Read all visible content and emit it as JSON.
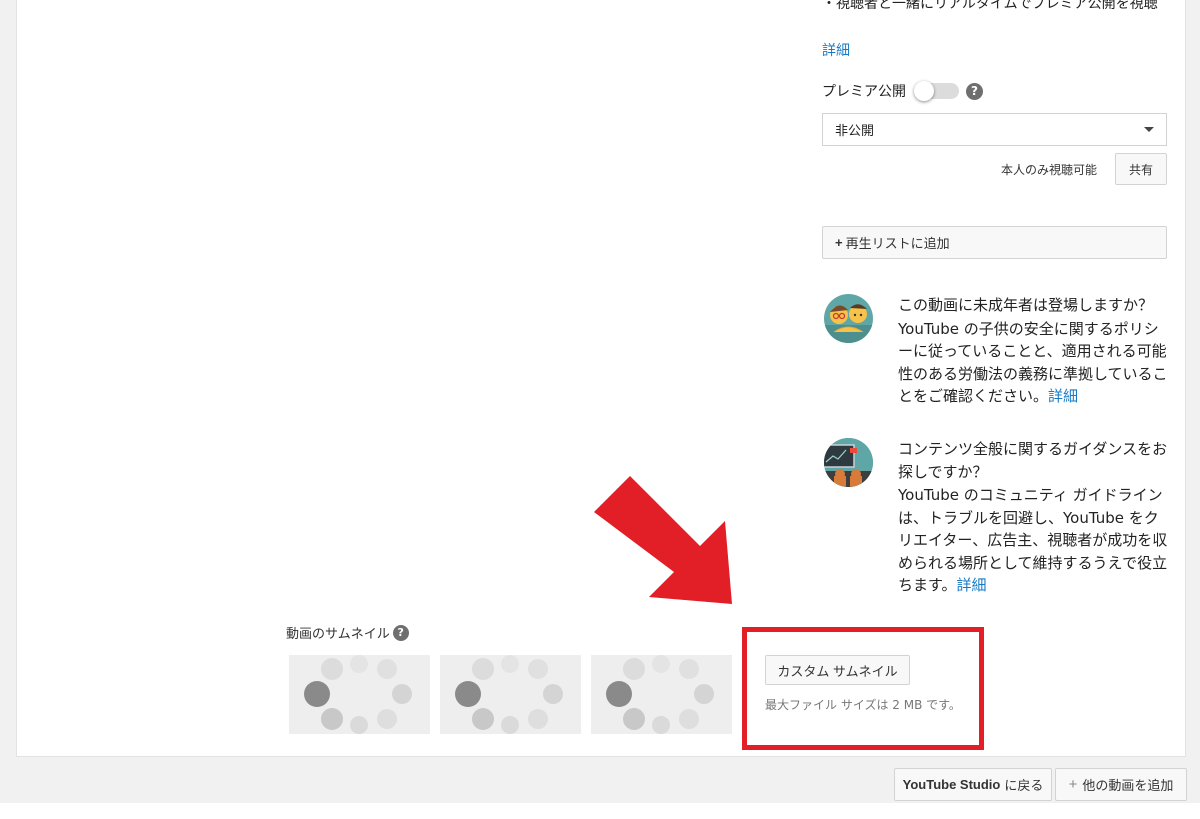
{
  "premiere_info": {
    "bullet_text": "・視聴者と一緒にリアルタイムでプレミア公開を視聴",
    "detail_link": "詳細"
  },
  "premiere": {
    "label": "プレミア公開",
    "toggle_on": false,
    "help_symbol": "?"
  },
  "visibility": {
    "selected": "非公開"
  },
  "share": {
    "note": "本人のみ視聴可能",
    "button": "共有"
  },
  "playlist": {
    "plus": "+",
    "label": "再生リストに追加"
  },
  "minors_notice": {
    "icon": "children-icon",
    "question": "この動画に未成年者は登場しますか？",
    "body": "YouTube の子供の安全に関するポリシーに従っていることと、適用される可能性のある労働法の義務に準拠していることをご確認ください。",
    "link": "詳細"
  },
  "guidance_notice": {
    "icon": "presentation-icon",
    "question": "コンテンツ全般に関するガイダンスをお探しですか？",
    "body": "YouTube のコミュニティ ガイドラインは、トラブルを回避し、YouTube をクリエイター、広告主、視聴者が成功を収められる場所として維持するうえで役立ちます。",
    "link": "詳細"
  },
  "thumbnails": {
    "label": "動画のサムネイル",
    "help_symbol": "?",
    "items": [
      "loading-spinner-icon",
      "loading-spinner-icon",
      "loading-spinner-icon"
    ]
  },
  "custom_thumbnail": {
    "button": "カスタム サムネイル",
    "note": "最大ファイル サイズは 2 MB です。"
  },
  "footer": {
    "studio_button_bold": "YouTube Studio",
    "studio_button_rest": "に戻る",
    "add_plus": "+",
    "add_button": "他の動画を追加"
  },
  "annotation": {
    "arrow_color": "#e21f26",
    "box_color": "#e21f26"
  }
}
